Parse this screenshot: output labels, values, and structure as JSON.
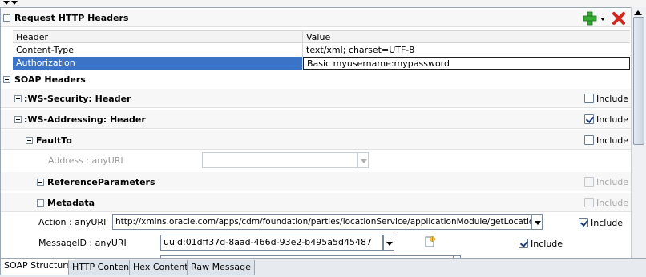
{
  "request_http_headers": {
    "title": "Request HTTP Headers",
    "add_icon": "plus-icon",
    "delete_icon": "x-icon",
    "columns": [
      "Header",
      "Value"
    ],
    "rows": [
      {
        "header": "Content-Type",
        "value": "text/xml; charset=UTF-8"
      },
      {
        "header": "Authorization",
        "value": "Basic myusername:mypassword"
      }
    ]
  },
  "soap_headers": {
    "title": "SOAP Headers",
    "ws_security": {
      "label": ":WS-Security: Header",
      "include": "Include",
      "checked": false
    },
    "ws_addressing": {
      "label": ":WS-Addressing: Header",
      "include": "Include",
      "checked": true
    },
    "fault_to": {
      "label": "FaultTo",
      "include": "Include",
      "checked": false,
      "address_label": "Address : anyURI",
      "address_value": ""
    },
    "reference_parameters": {
      "label": "ReferenceParameters",
      "include": "Include"
    },
    "metadata": {
      "label": "Metadata",
      "include": "Include"
    },
    "action": {
      "label": "Action : anyURI",
      "value": "http://xmlns.oracle.com/apps/cdm/foundation/parties/locationService/applicationModule/getLocationAsync",
      "include": "Include",
      "checked": true
    },
    "message_id": {
      "label": "MessageID : anyURI",
      "value": "uuid:01dff37d-8aad-466d-93e2-b495a5d45487",
      "include": "Include",
      "checked": true,
      "generate_icon": "new-id-icon"
    }
  },
  "tabs": [
    "SOAP Structure",
    "HTTP Content",
    "Hex Content",
    "Raw Message"
  ],
  "active_tab": "SOAP Structure",
  "colors": {
    "selection": "#3b74c7",
    "add_green": "#3aa935",
    "delete_red": "#d3261c"
  }
}
